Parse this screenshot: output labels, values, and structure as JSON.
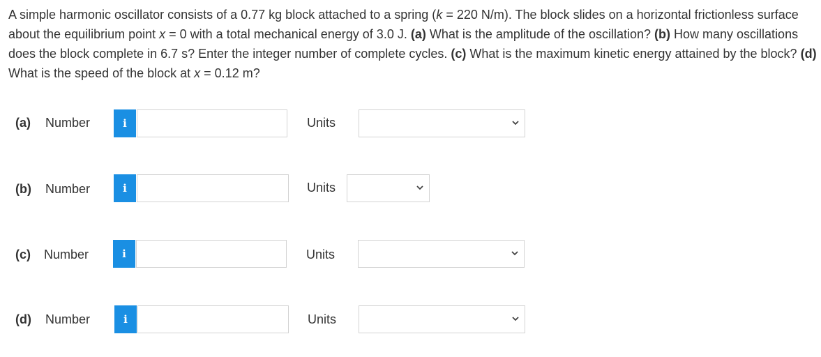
{
  "question": {
    "p1": "A simple harmonic oscillator consists of a 0.77 kg block attached to a spring (",
    "k_var": "k",
    "p2": " = 220 N/m). The block slides on a horizontal frictionless surface about the equilibrium point ",
    "x_var1": "x",
    "p3": " = 0 with a total mechanical energy of 3.0 J. ",
    "qa": "(a)",
    "p4": " What is the amplitude of the oscillation? ",
    "qb": "(b)",
    "p5": " How many oscillations does the block complete in 6.7 s? Enter the integer number of complete cycles. ",
    "qc": "(c)",
    "p6": " What is the maximum kinetic energy attained by the block? ",
    "qd": "(d)",
    "p7": " What is the speed of the block at ",
    "x_var2": "x",
    "p8": " = 0.12 m?"
  },
  "parts": [
    {
      "label": "(a)",
      "number_label": "Number",
      "info_icon": "i",
      "value": "",
      "units_label": "Units",
      "units_value": ""
    },
    {
      "label": "(b)",
      "number_label": "Number",
      "info_icon": "i",
      "value": "",
      "units_label": "Units",
      "units_value": ""
    },
    {
      "label": "(c)",
      "number_label": "Number",
      "info_icon": "i",
      "value": "",
      "units_label": "Units",
      "units_value": ""
    },
    {
      "label": "(d)",
      "number_label": "Number",
      "info_icon": "i",
      "value": "",
      "units_label": "Units",
      "units_value": ""
    }
  ],
  "colors": {
    "info_button": "#1a8fe3",
    "border": "#d3d3d3",
    "text": "#333333"
  }
}
